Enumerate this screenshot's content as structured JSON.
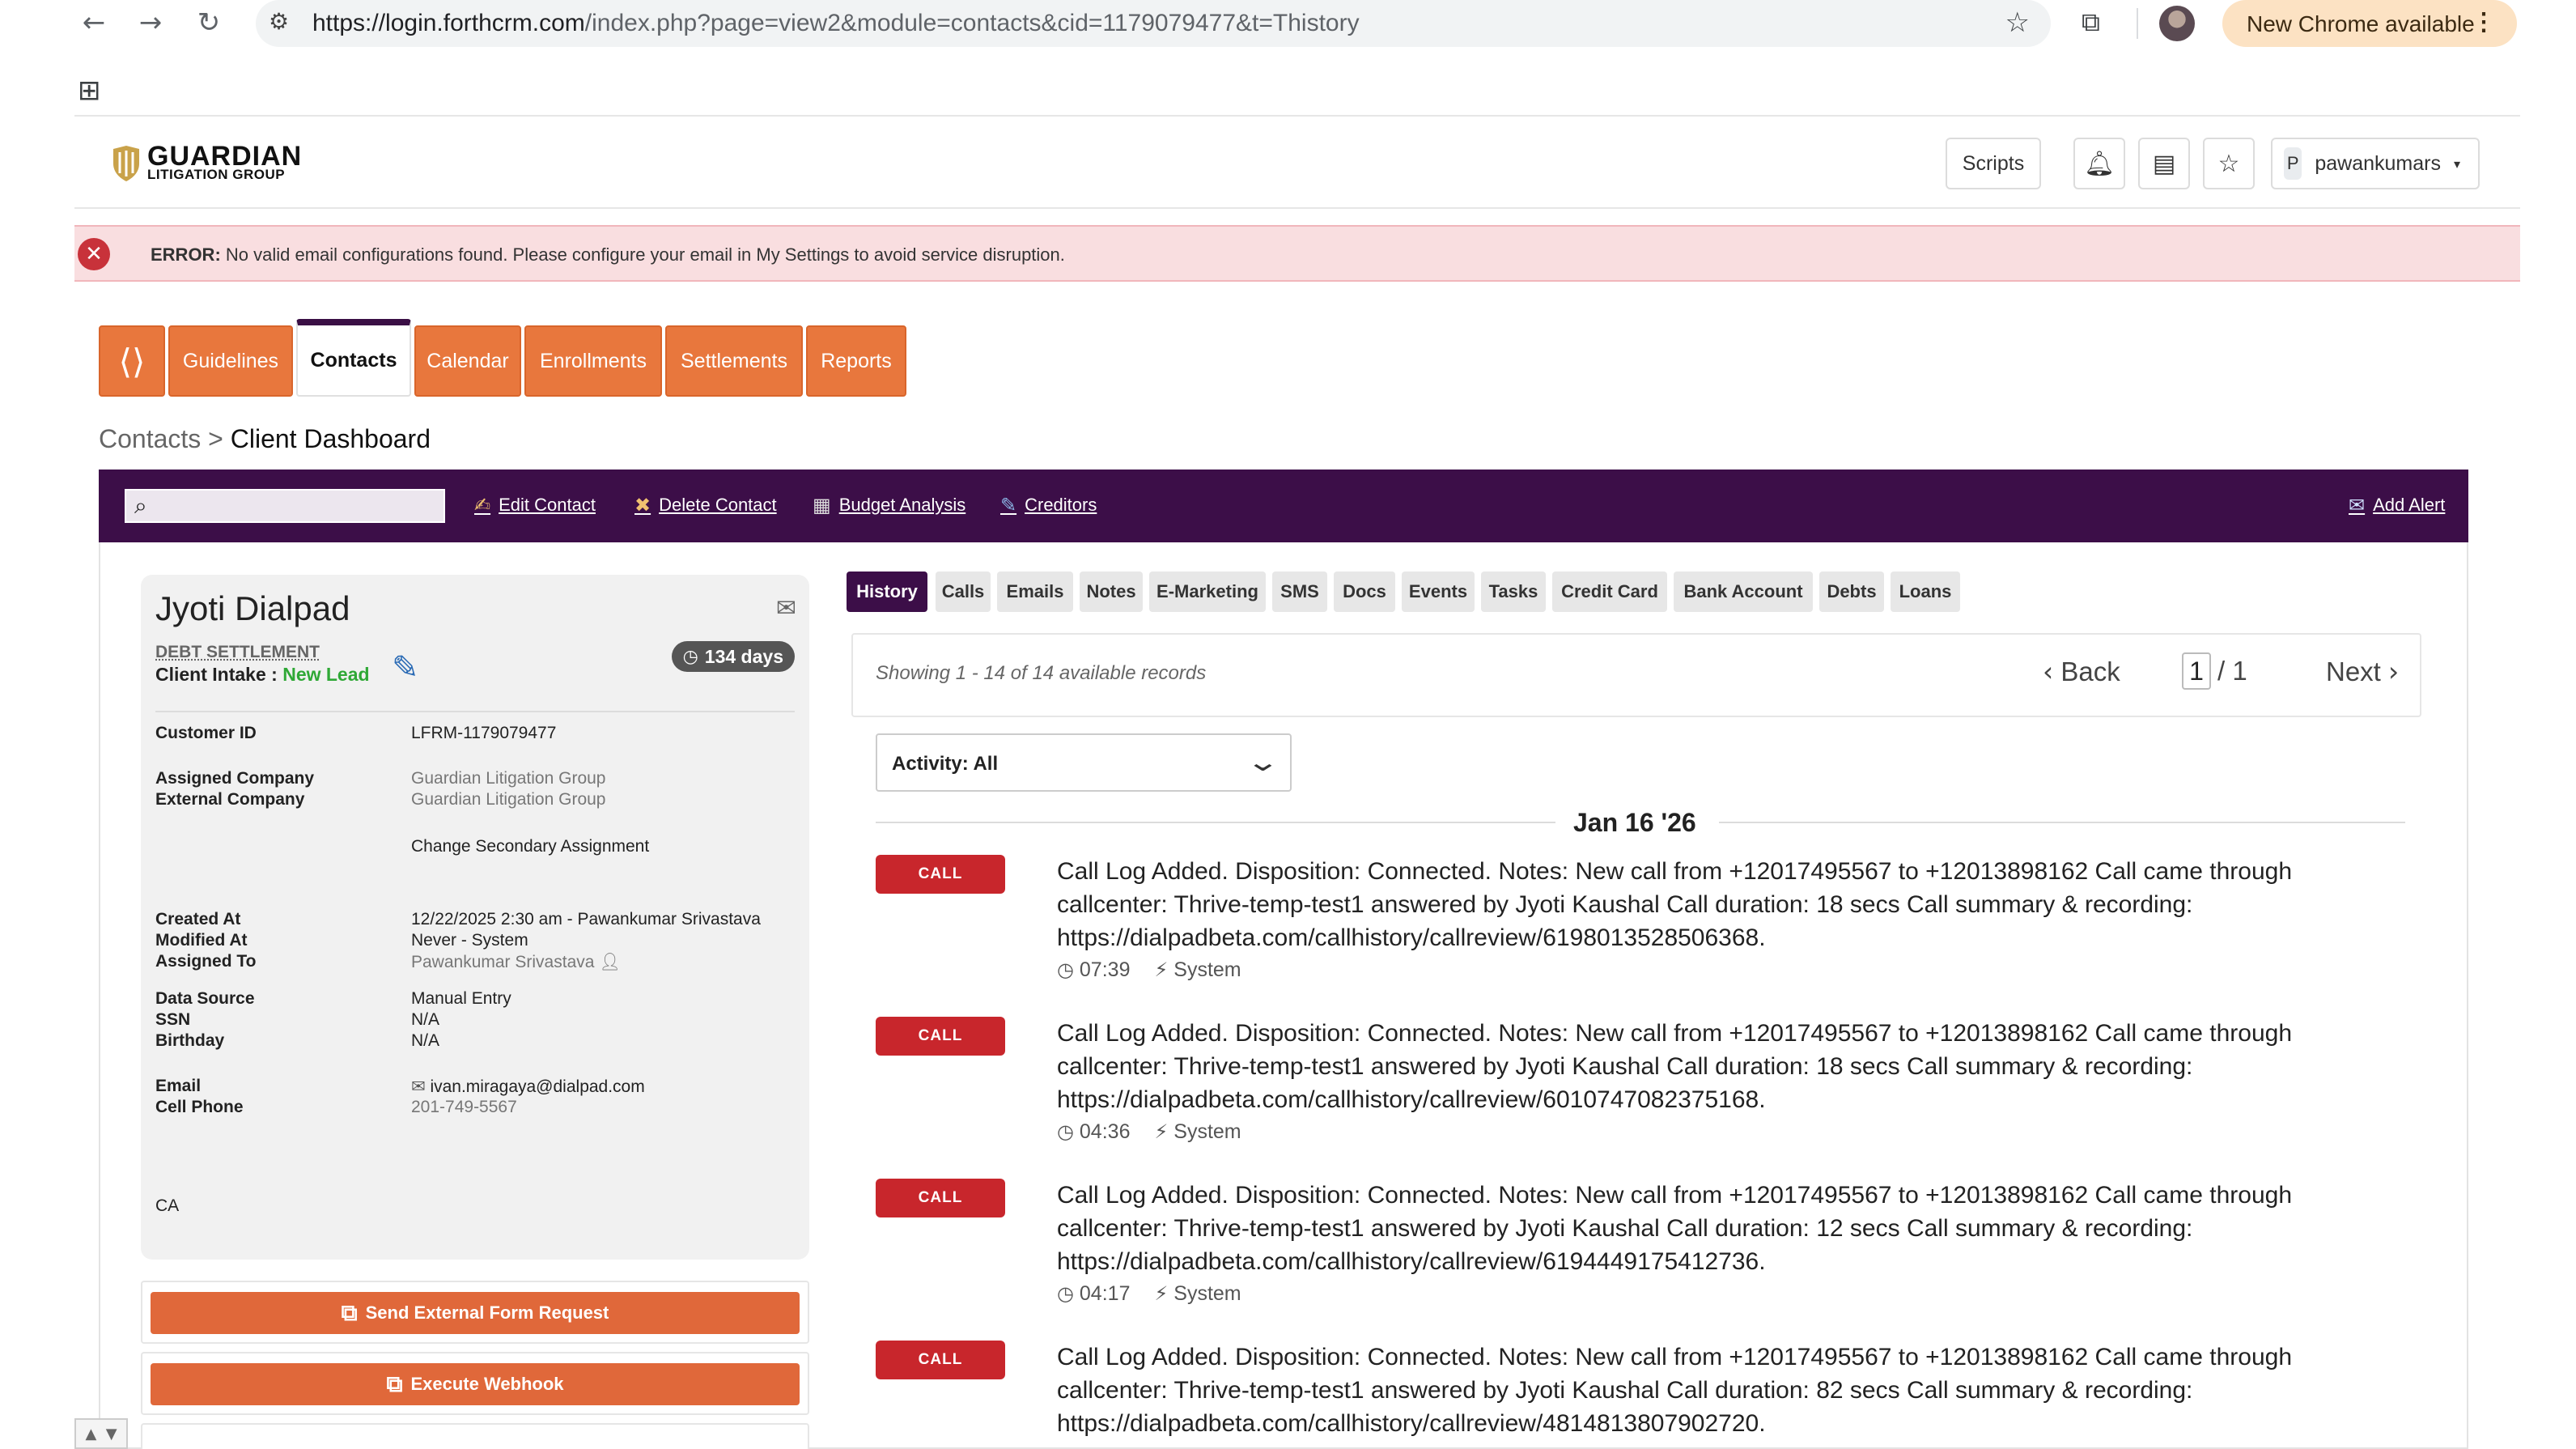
{
  "browser": {
    "url_host": "https://login.forthcrm.com",
    "url_path": "/index.php?page=view2&module=contacts&cid=1179079477&t=Thistory",
    "update_chip": "New Chrome available"
  },
  "header": {
    "logo_line1": "GUARDIAN",
    "logo_line2": "LITIGATION GROUP",
    "scripts_label": "Scripts",
    "user_initial": "P",
    "user_name": "pawankumars"
  },
  "error": {
    "label": "ERROR:",
    "message": "No valid email configurations found. Please configure your email in My Settings to avoid service disruption."
  },
  "nav_tabs": [
    "Guidelines",
    "Contacts",
    "Calendar",
    "Enrollments",
    "Settlements",
    "Reports"
  ],
  "breadcrumb": {
    "parent": "Contacts",
    "separator": ">",
    "current": "Client Dashboard"
  },
  "toolbar": {
    "edit_contact": "Edit Contact",
    "delete_contact": "Delete Contact",
    "budget_analysis": "Budget Analysis",
    "creditors": "Creditors",
    "add_alert": "Add Alert"
  },
  "contact": {
    "name": "Jyoti Dialpad",
    "program": "DEBT SETTLEMENT",
    "intake_label": "Client Intake :",
    "intake_status": "New Lead",
    "days": "134 days",
    "fields": {
      "customer_id_label": "Customer ID",
      "customer_id": "LFRM-1179079477",
      "assigned_company_label": "Assigned Company",
      "assigned_company": "Guardian Litigation Group",
      "external_company_label": "External Company",
      "external_company": "Guardian Litigation Group",
      "change_assignment": "Change Secondary Assignment",
      "created_at_label": "Created At",
      "created_at": "12/22/2025 2:30 am - Pawankumar Srivastava",
      "modified_at_label": "Modified At",
      "modified_at": "Never - System",
      "assigned_to_label": "Assigned To",
      "assigned_to": "Pawankumar Srivastava",
      "data_source_label": "Data Source",
      "data_source": "Manual Entry",
      "ssn_label": "SSN",
      "ssn": "N/A",
      "birthday_label": "Birthday",
      "birthday": "N/A",
      "email_label": "Email",
      "email": "ivan.miragaya@dialpad.com",
      "cell_phone_label": "Cell Phone",
      "cell_phone": "201-749-5567",
      "state": "CA"
    },
    "send_form_button": "Send External Form Request",
    "webhook_button": "Execute Webhook"
  },
  "history_tabs": [
    "History",
    "Calls",
    "Emails",
    "Notes",
    "E-Marketing",
    "SMS",
    "Docs",
    "Events",
    "Tasks",
    "Credit Card",
    "Bank Account",
    "Debts",
    "Loans"
  ],
  "pager": {
    "info": "Showing 1 - 14 of 14 available records",
    "back": "Back",
    "page": "1",
    "total": "/ 1",
    "next": "Next"
  },
  "activity_filter": "Activity: All",
  "date_group": "Jan 16 '26",
  "entries": [
    {
      "badge": "CALL",
      "text": "Call Log Added. Disposition: Connected. Notes: New call from +12017495567 to +12013898162 Call came through callcenter: Thrive-temp-test1 answered by Jyoti Kaushal Call duration: 18 secs Call summary & recording: https://dialpadbeta.com/callhistory/callreview/6198013528506368.",
      "time": "07:39",
      "source": "System"
    },
    {
      "badge": "CALL",
      "text": "Call Log Added. Disposition: Connected. Notes: New call from +12017495567 to +12013898162 Call came through callcenter: Thrive-temp-test1 answered by Jyoti Kaushal Call duration: 18 secs Call summary & recording: https://dialpadbeta.com/callhistory/callreview/6010747082375168.",
      "time": "04:36",
      "source": "System"
    },
    {
      "badge": "CALL",
      "text": "Call Log Added. Disposition: Connected. Notes: New call from +12017495567 to +12013898162 Call came through callcenter: Thrive-temp-test1 answered by Jyoti Kaushal Call duration: 12 secs Call summary & recording: https://dialpadbeta.com/callhistory/callreview/6194449175412736.",
      "time": "04:17",
      "source": "System"
    },
    {
      "badge": "CALL",
      "text": "Call Log Added. Disposition: Connected. Notes: New call from +12017495567 to +12013898162 Call came through callcenter: Thrive-temp-test1 answered by Jyoti Kaushal Call duration: 82 secs Call summary & recording: https://dialpadbeta.com/callhistory/callreview/4814813807902720.",
      "time": "",
      "source": ""
    }
  ],
  "colors": {
    "accent_orange": "#e8773d",
    "brand_purple": "#3c0e48",
    "call_red": "#c8262c",
    "lead_green": "#2fa836",
    "error_bg": "#f9dee0"
  },
  "icons": [
    "back-arrow-icon",
    "forward-arrow-icon",
    "reload-icon",
    "site-info-icon",
    "star-icon",
    "bell-icon",
    "inbox-icon",
    "search-icon",
    "mail-icon",
    "edit-icon",
    "clock-icon",
    "bolt-icon",
    "external-link-icon"
  ]
}
